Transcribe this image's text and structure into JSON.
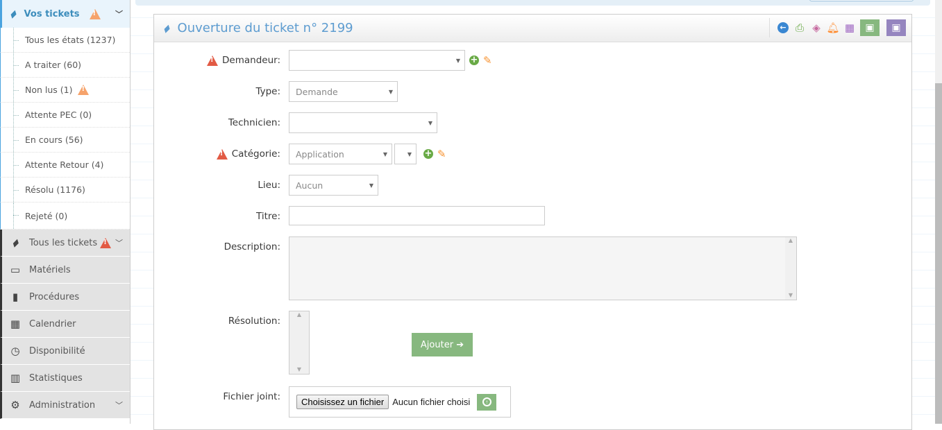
{
  "sidebar": {
    "active": {
      "label": "Vos tickets",
      "icon": "ticket-icon"
    },
    "subitems": [
      "Tous les états (1237)",
      "A traiter (60)",
      "Non lus (1)",
      "Attente PEC (0)",
      "En cours (56)",
      "Attente Retour (4)",
      "Résolu (1176)",
      "Rejeté (0)"
    ],
    "items": [
      {
        "label": "Tous les tickets",
        "icon": "ticket-icon"
      },
      {
        "label": "Matériels",
        "icon": "desktop-icon"
      },
      {
        "label": "Procédures",
        "icon": "book-icon"
      },
      {
        "label": "Calendrier",
        "icon": "calendar-icon"
      },
      {
        "label": "Disponibilité",
        "icon": "clock-icon"
      },
      {
        "label": "Statistiques",
        "icon": "bar-chart-icon"
      },
      {
        "label": "Administration",
        "icon": "cogs-icon"
      }
    ]
  },
  "panel": {
    "title": "Ouverture du ticket n° 2199",
    "toolbar": [
      "back-icon",
      "print-icon",
      "tags-icon",
      "bell-icon",
      "calendar-icon",
      "save-icon",
      "save-close-icon"
    ]
  },
  "form": {
    "demandeur": {
      "label": "Demandeur:",
      "value": ""
    },
    "type": {
      "label": "Type:",
      "value": "Demande"
    },
    "technicien": {
      "label": "Technicien:",
      "value": ""
    },
    "categorie": {
      "label": "Catégorie:",
      "value": "Application",
      "sub": ""
    },
    "lieu": {
      "label": "Lieu:",
      "value": "Aucun"
    },
    "titre": {
      "label": "Titre:",
      "value": ""
    },
    "description": {
      "label": "Description:",
      "value": ""
    },
    "resolution": {
      "label": "Résolution:",
      "value": "",
      "add_button": "Ajouter"
    },
    "fichier": {
      "label": "Fichier joint:",
      "choose_button": "Choisissez un fichier",
      "status": "Aucun fichier choisi"
    }
  },
  "colors": {
    "accent": "#5d9cd0",
    "green": "#87b87f",
    "purple": "#9585bf",
    "warning": "#e25a44"
  }
}
